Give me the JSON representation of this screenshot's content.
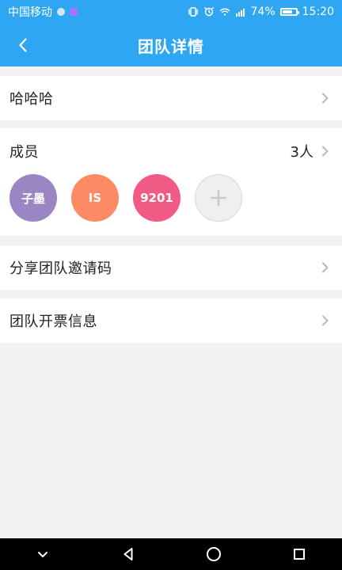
{
  "status_bar": {
    "carrier": "中国移动",
    "battery_percent_text": "74%",
    "battery_level_percent": 74,
    "time": "15:20",
    "icons": [
      "notification-app-icon",
      "notification-shield-icon",
      "vibrate-icon",
      "alarm-icon",
      "wifi-icon",
      "signal-icon",
      "battery-icon"
    ]
  },
  "header": {
    "title": "团队详情",
    "back_icon": "back-icon",
    "accent_color": "#2fa6f2"
  },
  "team": {
    "name": "哈哈哈"
  },
  "members": {
    "label": "成员",
    "count_text": "3人",
    "avatars": [
      {
        "label": "子墨",
        "color": "#9b86c4"
      },
      {
        "label": "IS",
        "color": "#ff8a66"
      },
      {
        "label": "9201",
        "color": "#f25a86"
      }
    ],
    "add_icon": "add-icon"
  },
  "actions": {
    "share_invite_code": "分享团队邀请码",
    "invoice_info": "团队开票信息"
  },
  "navigation_bar": {
    "buttons": [
      "chevron-down-icon",
      "back-triangle-icon",
      "home-circle-icon",
      "recents-square-icon"
    ]
  }
}
